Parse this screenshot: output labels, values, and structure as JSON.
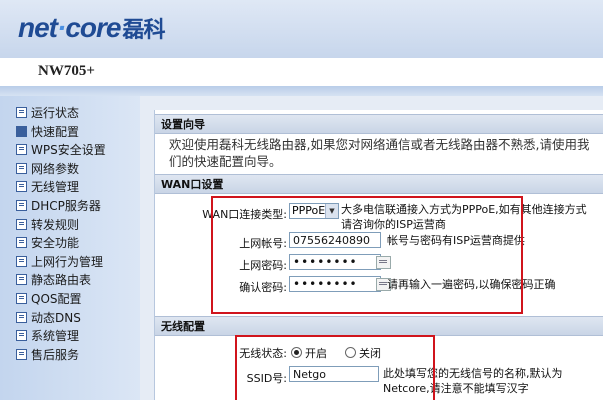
{
  "brand": {
    "logo_net": "net",
    "logo_dot": "·",
    "logo_core": "core",
    "logo_cn": "磊科"
  },
  "model": "NW705+",
  "sidebar": {
    "items": [
      {
        "label": "运行状态",
        "active": false
      },
      {
        "label": "快速配置",
        "active": true
      },
      {
        "label": "WPS安全设置",
        "active": false
      },
      {
        "label": "网络参数",
        "active": false
      },
      {
        "label": "无线管理",
        "active": false
      },
      {
        "label": "DHCP服务器",
        "active": false
      },
      {
        "label": "转发规则",
        "active": false
      },
      {
        "label": "安全功能",
        "active": false
      },
      {
        "label": "上网行为管理",
        "active": false
      },
      {
        "label": "静态路由表",
        "active": false
      },
      {
        "label": "QOS配置",
        "active": false
      },
      {
        "label": "动态DNS",
        "active": false
      },
      {
        "label": "系统管理",
        "active": false
      },
      {
        "label": "售后服务",
        "active": false
      }
    ]
  },
  "wizard": {
    "title": "设置向导",
    "welcome": "欢迎使用磊科无线路由器,如果您对网络通信或者无线路由器不熟悉,请使用我们的快速配置向导。"
  },
  "wan": {
    "title": "WAN口设置",
    "conn_type_label": "WAN口连接类型:",
    "conn_type_value": "PPPoE",
    "conn_type_hint": "大多电信联通接入方式为PPPoE,如有其他连接方式请咨询你的ISP运营商",
    "account_label": "上网帐号:",
    "account_value": "07556240890",
    "account_hint": "帐号与密码有ISP运营商提供",
    "password_label": "上网密码:",
    "password_value": "••••••••",
    "confirm_label": "确认密码:",
    "confirm_value": "••••••••",
    "confirm_hint": "请再输入一遍密码,以确保密码正确"
  },
  "wireless": {
    "title": "无线配置",
    "status_label": "无线状态:",
    "status_on": "开启",
    "status_off": "关闭",
    "ssid_label": "SSID号:",
    "ssid_value": "Netgo",
    "ssid_hint": "此处填写您的无线信号的名称,默认为Netcore,请注意不能填写汉字"
  },
  "colors": {
    "accent": "#1f4b94",
    "highlight": "#d0141c",
    "sidebar": "#c3d5ee"
  }
}
